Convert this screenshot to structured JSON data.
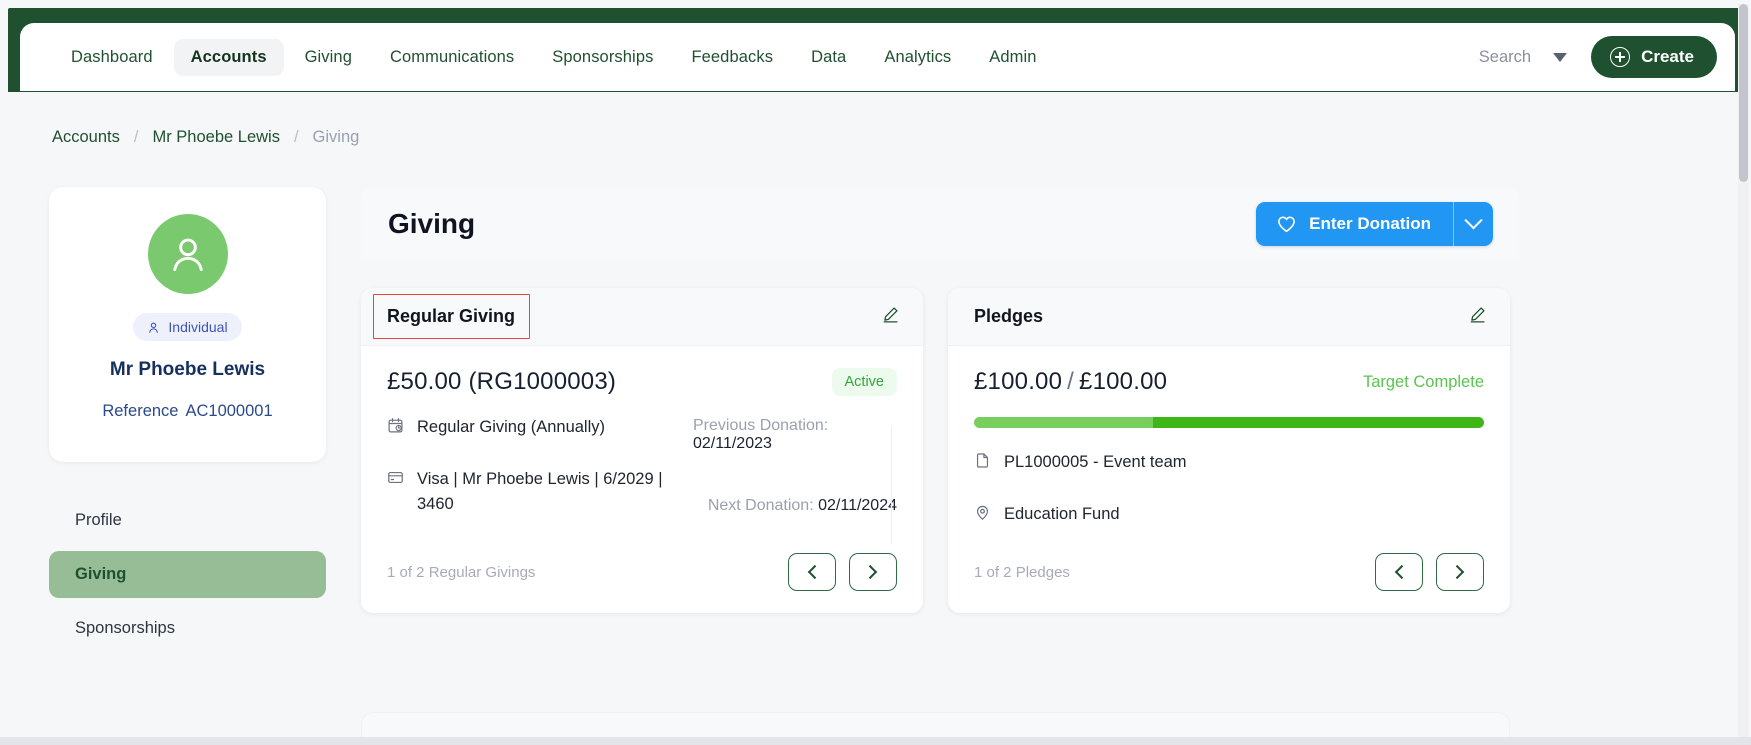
{
  "nav": {
    "items": [
      {
        "label": "Dashboard",
        "active": false
      },
      {
        "label": "Accounts",
        "active": true
      },
      {
        "label": "Giving",
        "active": false
      },
      {
        "label": "Communications",
        "active": false
      },
      {
        "label": "Sponsorships",
        "active": false
      },
      {
        "label": "Feedbacks",
        "active": false
      },
      {
        "label": "Data",
        "active": false
      },
      {
        "label": "Analytics",
        "active": false
      },
      {
        "label": "Admin",
        "active": false
      }
    ],
    "search_label": "Search",
    "create_label": "Create",
    "brand_color": "#1f5130"
  },
  "breadcrumb": {
    "items": [
      "Accounts",
      "Mr Phoebe Lewis",
      "Giving"
    ],
    "separator": "/"
  },
  "profile": {
    "type_badge": "Individual",
    "name": "Mr Phoebe Lewis",
    "reference_label": "Reference",
    "reference_value": "AC1000001",
    "avatar_color": "#7bc96f"
  },
  "sidebar": {
    "items": [
      {
        "label": "Profile",
        "active": false
      },
      {
        "label": "Giving",
        "active": true
      },
      {
        "label": "Sponsorships",
        "active": false
      }
    ],
    "active_color": "#96bd96"
  },
  "main": {
    "title": "Giving",
    "enter_donation_label": "Enter Donation",
    "donation_button_color": "#2196f3"
  },
  "regular_giving": {
    "card_title": "Regular Giving",
    "amount": "£50.00 (RG1000003)",
    "status": "Active",
    "status_color": "#34a53a",
    "frequency": "Regular Giving (Annually)",
    "payment_method": "Visa | Mr Phoebe Lewis | 6/2029 | 3460",
    "previous_donation_label": "Previous Donation:",
    "previous_donation_value": "02/11/2023",
    "next_donation_label": "Next Donation",
    "next_donation_value": "02/11/2024",
    "footer_count": "1 of 2",
    "footer_noun": "Regular Givings",
    "highlight_color": "#e8453c"
  },
  "pledges": {
    "card_title": "Pledges",
    "amount_raised": "£100.00",
    "amount_separator": "/",
    "amount_target": "£100.00",
    "status": "Target Complete",
    "status_color": "#5ac451",
    "progress_percent": 100,
    "progress_split_percent": 35,
    "progress_color_light": "#79cf5e",
    "progress_color_dark": "#3fb618",
    "reference_line": "PL1000005 - Event team",
    "fund_line": "Education Fund",
    "footer_count": "1 of 2",
    "footer_noun": "Pledges"
  }
}
